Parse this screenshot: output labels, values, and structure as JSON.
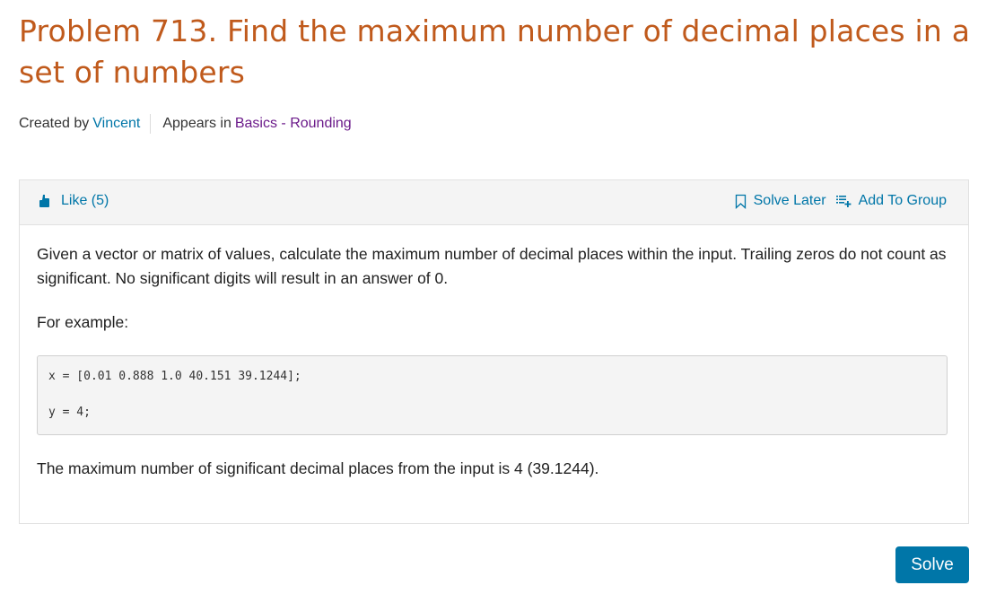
{
  "problem": {
    "title": "Problem 713. Find the maximum number of decimal places in a set of numbers",
    "created_by_label": "Created by",
    "author": "Vincent",
    "appears_in_label": "Appears in",
    "group": "Basics - Rounding"
  },
  "toolbar": {
    "like_label": "Like (5)",
    "like_icon": "thumbs-up-icon",
    "solve_later_label": "Solve Later",
    "solve_later_icon": "bookmark-icon",
    "add_to_group_label": "Add To Group",
    "add_to_group_icon": "playlist-add-icon"
  },
  "description": {
    "paragraph": "Given a vector or matrix of values, calculate the maximum number of decimal places within the input. Trailing zeros do not count as significant. No significant digits will result in an answer of 0.",
    "example_label": "For example:",
    "code_lines": [
      "x = [0.01 0.888 1.0 40.151 39.1244];",
      "y = 4;"
    ],
    "conclusion": "The maximum number of significant decimal places from the input is 4 (39.1244)."
  },
  "actions": {
    "solve_label": "Solve"
  },
  "colors": {
    "title": "#c05a1c",
    "link": "#0076a8",
    "visited_link": "#6b1a8a",
    "button": "#0076a8"
  }
}
